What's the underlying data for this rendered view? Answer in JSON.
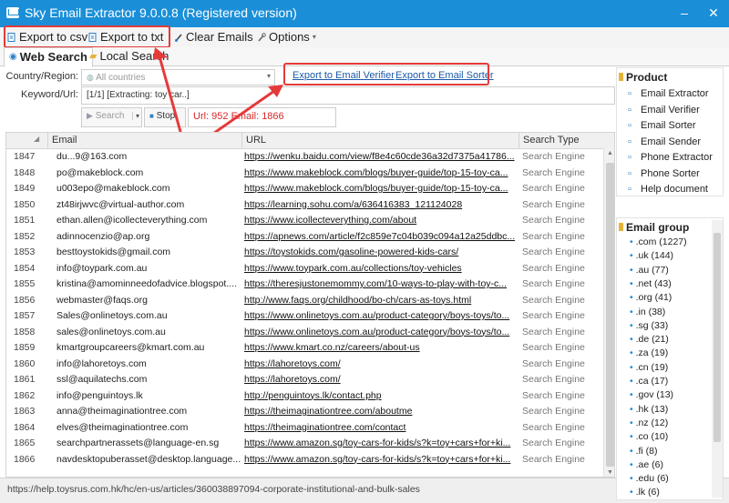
{
  "window": {
    "title": "Sky Email Extractor 9.0.0.8 (Registered version)",
    "minimize": "–",
    "close": "✕"
  },
  "menu": {
    "export_csv": "Export to csv",
    "export_txt": "Export to txt",
    "clear": "Clear Emails",
    "options": "Options"
  },
  "tabs": {
    "web": "Web Search",
    "local": "Local Search"
  },
  "form": {
    "country_label": "Country/Region:",
    "country_value": "All countries",
    "keyword_label": "Keyword/Url:",
    "keyword_value": "[1/1] [Extracting: toy car..]",
    "search_btn": "Search",
    "stop_btn": "Stop",
    "stats": "Url: 952 Email: 1866",
    "verifier_link": "Export to Email Verifier",
    "sorter_link": "Export to Email Sorter"
  },
  "grid": {
    "columns": {
      "email": "Email",
      "url": "URL",
      "type": "Search Type"
    },
    "rows": [
      {
        "n": "1847",
        "email": "du...9@163.com",
        "url": "https://wenku.baidu.com/view/f8e4c60cde36a32d7375a41786...",
        "type": "Search Engine"
      },
      {
        "n": "1848",
        "email": "po@makeblock.com",
        "url": "https://www.makeblock.com/blogs/buyer-guide/top-15-toy-ca...",
        "type": "Search Engine"
      },
      {
        "n": "1849",
        "email": "u003epo@makeblock.com",
        "url": "https://www.makeblock.com/blogs/buyer-guide/top-15-toy-ca...",
        "type": "Search Engine"
      },
      {
        "n": "1850",
        "email": "zt48irjwvc@virtual-author.com",
        "url": "https://learning.sohu.com/a/636416383_121124028",
        "type": "Search Engine"
      },
      {
        "n": "1851",
        "email": "ethan.allen@icollecteverything.com",
        "url": "https://www.icollecteverything.com/about",
        "type": "Search Engine"
      },
      {
        "n": "1852",
        "email": "adinnocenzio@ap.org",
        "url": "https://apnews.com/article/f2c859e7c04b039c094a12a25ddbc...",
        "type": "Search Engine"
      },
      {
        "n": "1853",
        "email": "besttoystokids@gmail.com",
        "url": "https://toystokids.com/gasoline-powered-kids-cars/",
        "type": "Search Engine"
      },
      {
        "n": "1854",
        "email": "info@toypark.com.au",
        "url": "https://www.toypark.com.au/collections/toy-vehicles",
        "type": "Search Engine"
      },
      {
        "n": "1855",
        "email": "kristina@amominneedofadvice.blogspot....",
        "url": "https://theresjustonemommy.com/10-ways-to-play-with-toy-c...",
        "type": "Search Engine"
      },
      {
        "n": "1856",
        "email": "webmaster@faqs.org",
        "url": "http://www.faqs.org/childhood/bo-ch/cars-as-toys.html",
        "type": "Search Engine"
      },
      {
        "n": "1857",
        "email": "Sales@onlinetoys.com.au",
        "url": "https://www.onlinetoys.com.au/product-category/boys-toys/to...",
        "type": "Search Engine"
      },
      {
        "n": "1858",
        "email": "sales@onlinetoys.com.au",
        "url": "https://www.onlinetoys.com.au/product-category/boys-toys/to...",
        "type": "Search Engine"
      },
      {
        "n": "1859",
        "email": "kmartgroupcareers@kmart.com.au",
        "url": "https://www.kmart.co.nz/careers/about-us",
        "type": "Search Engine"
      },
      {
        "n": "1860",
        "email": "info@lahoretoys.com",
        "url": "https://lahoretoys.com/",
        "type": "Search Engine"
      },
      {
        "n": "1861",
        "email": "ssl@aquilatechs.com",
        "url": "https://lahoretoys.com/",
        "type": "Search Engine"
      },
      {
        "n": "1862",
        "email": "info@penguintoys.lk",
        "url": "http://penguintoys.lk/contact.php",
        "type": "Search Engine"
      },
      {
        "n": "1863",
        "email": "anna@theimaginationtree.com",
        "url": "https://theimaginationtree.com/aboutme",
        "type": "Search Engine"
      },
      {
        "n": "1864",
        "email": "elves@theimaginationtree.com",
        "url": "https://theimaginationtree.com/contact",
        "type": "Search Engine"
      },
      {
        "n": "1865",
        "email": "searchpartnerassets@language-en.sg",
        "url": "https://www.amazon.sg/toy-cars-for-kids/s?k=toy+cars+for+ki...",
        "type": "Search Engine"
      },
      {
        "n": "1866",
        "email": "navdesktopuberasset@desktop.language...",
        "url": "https://www.amazon.sg/toy-cars-for-kids/s?k=toy+cars+for+ki...",
        "type": "Search Engine"
      }
    ]
  },
  "status": "https://help.toysrus.com.hk/hc/en-us/articles/360038897094-corporate-institutional-and-bulk-sales",
  "product": {
    "title": "Product",
    "items": [
      "Email Extractor",
      "Email Verifier",
      "Email Sorter",
      "Email Sender",
      "Phone Extractor",
      "Phone Sorter",
      "Help document"
    ]
  },
  "email_group": {
    "title": "Email group",
    "items": [
      ".com (1227)",
      ".uk (144)",
      ".au (77)",
      ".net (43)",
      ".org (41)",
      ".in (38)",
      ".sg (33)",
      ".de (21)",
      ".za (19)",
      ".cn (19)",
      ".ca (17)",
      ".gov (13)",
      ".hk (13)",
      ".nz (12)",
      ".co (10)",
      ".fi (8)",
      ".ae (6)",
      ".edu (6)",
      ".lk (6)"
    ]
  },
  "colors": {
    "titlebar": "#1a8fd8",
    "highlight": "#e53a3a",
    "link": "#1a5aa8"
  }
}
